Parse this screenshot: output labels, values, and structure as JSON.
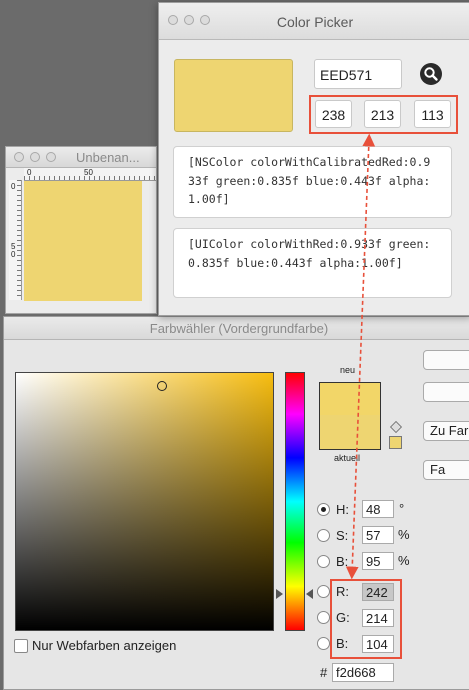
{
  "color_picker": {
    "title": "Color Picker",
    "hex_value": "EED571",
    "rgb": [
      "238",
      "213",
      "113"
    ],
    "nscolor_code": "[NSColor colorWithCalibratedRed:0.933f green:0.835f blue:0.443f alpha:1.00f]",
    "uicolor_code": "[UIColor colorWithRed:0.933f green:0.835f blue:0.443f alpha:1.00f]",
    "swatch_color": "#eed571"
  },
  "document_window": {
    "title": "Unbenan...",
    "ruler_top_labels": [
      "0",
      "50"
    ],
    "ruler_left_labels": [
      "0",
      "5",
      "0"
    ]
  },
  "ps_picker": {
    "title": "Farbwähler (Vordergrundfarbe)",
    "new_label": "neu",
    "current_label": "aktuell",
    "new_color": "#f2d668",
    "current_color": "#eed571",
    "web_colors_label": "Nur Webfarben anzeigen",
    "buttons": [
      "",
      "",
      "Zu Far",
      "Fa"
    ],
    "hsb": [
      {
        "label": "H:",
        "value": "48",
        "unit": "°"
      },
      {
        "label": "S:",
        "value": "57",
        "unit": "%"
      },
      {
        "label": "B:",
        "value": "95",
        "unit": "%"
      }
    ],
    "rgb": [
      {
        "label": "R:",
        "value": "242"
      },
      {
        "label": "G:",
        "value": "214"
      },
      {
        "label": "B:",
        "value": "104"
      }
    ],
    "hex_prefix": "#",
    "hex_value": "f2d668"
  },
  "colors": {
    "highlight": "#e8503a",
    "sample_yellow": "#eed571"
  }
}
